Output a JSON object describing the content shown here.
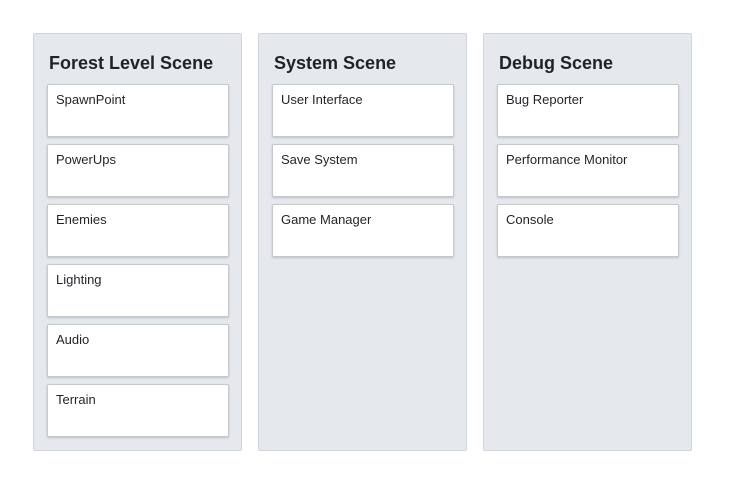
{
  "columns": [
    {
      "title": "Forest Level Scene",
      "cards": [
        "SpawnPoint",
        "PowerUps",
        "Enemies",
        "Lighting",
        "Audio",
        "Terrain"
      ]
    },
    {
      "title": "System Scene",
      "cards": [
        "User Interface",
        "Save System",
        "Game Manager"
      ]
    },
    {
      "title": "Debug Scene",
      "cards": [
        "Bug Reporter",
        "Performance Monitor",
        "Console"
      ]
    }
  ]
}
